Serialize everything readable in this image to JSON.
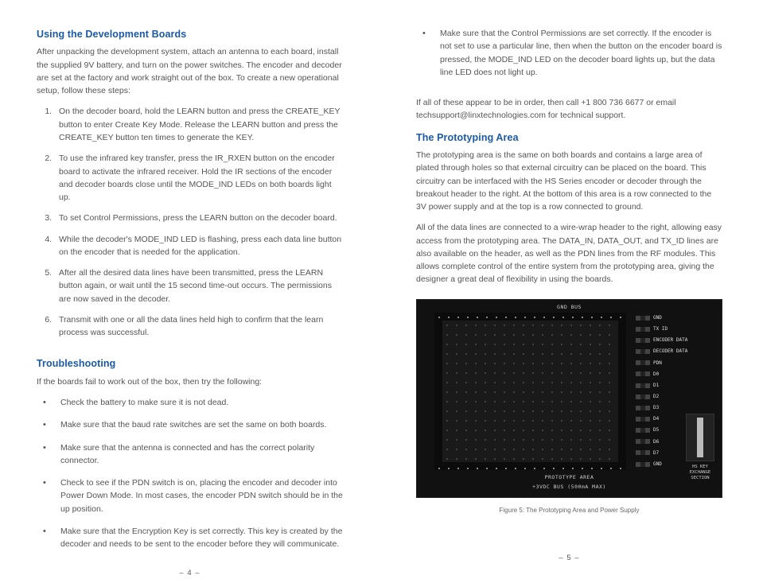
{
  "left": {
    "h1": "Using the Development Boards",
    "intro": "After unpacking the development system, attach an antenna to each board, install the supplied 9V battery, and turn on the power switches. The encoder and decoder are set at the factory and work straight out of the box. To create a new operational setup, follow these steps:",
    "steps": [
      "On the decoder board, hold the LEARN button and press the CREATE_KEY button to enter Create Key Mode. Release the LEARN button and press the CREATE_KEY button ten times to generate the KEY.",
      "To use the infrared key transfer, press the IR_RXEN button on the encoder board to activate the infrared receiver. Hold the IR sections of the encoder and decoder boards close until the MODE_IND LEDs on both boards light up.",
      "To set Control Permissions, press the LEARN button on the decoder board.",
      "While the decoder's MODE_IND LED is flashing, press each data line button on the encoder that is needed for the application.",
      "After all the desired data lines have been transmitted, press the LEARN button again, or wait until the 15 second time-out occurs. The permissions are now saved in the decoder.",
      "Transmit with one or all the data lines held high to confirm that the learn process was successful."
    ],
    "h2": "Troubleshooting",
    "tintro": "If the boards fail to work out of the box, then try the following:",
    "tips": [
      "Check the battery to make sure it is not dead.",
      "Make sure that the baud rate switches are set the same on both boards.",
      "Make sure that the antenna is connected and has the correct polarity connector.",
      "Check to see if the PDN switch is on, placing the encoder and decoder into Power Down Mode. In most cases, the encoder PDN switch should be in the up position.",
      "Make sure that the Encryption Key is set correctly. This key is created by the decoder and needs to be sent to the encoder before they will communicate."
    ],
    "pageno": "– 4 –"
  },
  "right": {
    "cont": [
      "Make sure that the Control Permissions are set correctly. If the encoder is not set to use a particular line, then when the button on the encoder board is pressed, the MODE_IND LED on the decoder board lights up, but the data line LED does not light up."
    ],
    "contact": "If all of these appear to be in order, then call +1 800 736 6677 or email techsupport@linxtechnologies.com for technical support.",
    "h1": "The Prototyping Area",
    "p1": "The prototyping area is the same on both boards and contains a large area of plated through holes so that external circuitry can be placed on the board. This circuitry can be interfaced with the HS Series encoder or decoder through the breakout header to the right. At the bottom of this area is a row connected to the 3V power supply and at the top is a row connected to ground.",
    "p2": "All of the data lines are connected to a wire-wrap header to the right, allowing easy access from the prototyping area. The DATA_IN, DATA_OUT, and TX_ID lines are also available on the header, as well as the PDN lines from the RF modules. This allows complete control of the entire system from the prototyping area, giving the designer a great deal of flexibility in using the boards.",
    "fig": {
      "silk_top": "GND BUS",
      "silk_bot1": "PROTOTYPE AREA",
      "silk_bot2": "+3VDC BUS (500mA MAX)",
      "pins": [
        "GND",
        "TX ID",
        "ENCODER DATA",
        "DECODER DATA",
        "PDN",
        "D0",
        "D1",
        "D2",
        "D3",
        "D4",
        "D5",
        "D6",
        "D7",
        "GND"
      ],
      "switch_labels1": "HS\nKEY EXCHANGE\nSECTION"
    },
    "caption": "Figure 5: The Prototyping Area and Power Supply",
    "pageno": "– 5 –"
  }
}
